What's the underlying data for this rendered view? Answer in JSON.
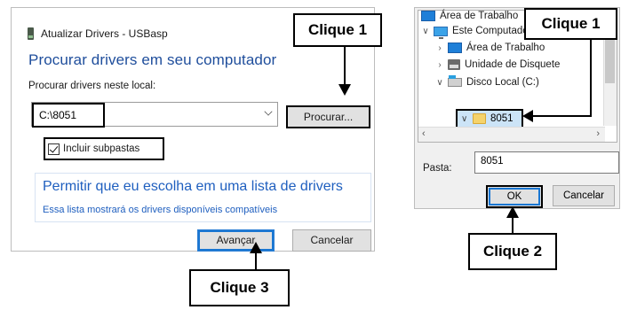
{
  "left_dialog": {
    "title": "Atualizar Drivers - USBasp",
    "heading": "Procurar drivers em seu computador",
    "location_label": "Procurar drivers neste local:",
    "path_value": "C:\\8051",
    "browse_button": "Procurar...",
    "include_subfolders": "Incluir subpastas",
    "include_subfolders_checked": true,
    "list_link_title": "Permitir que eu escolha em uma lista de drivers",
    "list_link_subtitle": "Essa lista mostrará os drivers disponíveis compatíveis",
    "next_button": "Avançar",
    "cancel_button": "Cancelar"
  },
  "right_dialog": {
    "tree": {
      "area_trabalho_top": "Área de Trabalho",
      "este_computador": "Este Computador",
      "area_trabalho_child": "Área de Trabalho",
      "unidade_disquete": "Unidade de Disquete",
      "disco_local": "Disco Local (C:)",
      "folder_8051": "8051"
    },
    "folder_label": "Pasta:",
    "folder_value": "8051",
    "ok_button": "OK",
    "cancel_button": "Cancelar"
  },
  "callouts": {
    "clique1_left": "Clique 1",
    "clique1_right": "Clique 1",
    "clique2": "Clique 2",
    "clique3": "Clique 3"
  },
  "icons": {
    "app": "usb-device-icon",
    "desktop": "desktop-icon",
    "computer": "computer-icon",
    "floppy": "floppy-disk-icon",
    "drive": "local-disk-icon",
    "folder": "folder-icon"
  }
}
